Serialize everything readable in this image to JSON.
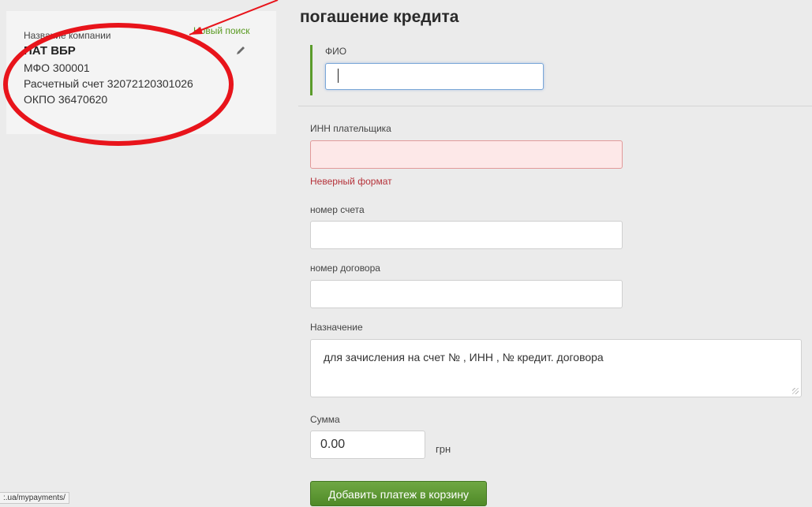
{
  "company": {
    "label": "Название компании",
    "new_search": "Новый поиск",
    "name": "ПАТ ВБР",
    "mfo": "МФО 300001",
    "account": "Расчетный счет 32072120301026",
    "okpo": "ОКПО 36470620"
  },
  "form": {
    "title": "погашение кредита",
    "fio_label": "ФИО",
    "fio_value": "",
    "inn_label": "ИНН плательщика",
    "inn_value": "",
    "inn_error": "Неверный формат",
    "account_label": "номер счета",
    "account_value": "",
    "contract_label": "номер договора",
    "contract_value": "",
    "purpose_label": "Назначение",
    "purpose_value": "для зачисления на счет № ,  ИНН , № кредит. договора",
    "amount_label": "Сумма",
    "amount_value": "0.00",
    "currency": "грн",
    "submit_label": "Добавить платеж в корзину"
  },
  "status_bar": {
    "url": ":.ua/mypayments/"
  },
  "colors": {
    "accent_green": "#5b9c2b",
    "error_red": "#b5323a",
    "annotation_red": "#e8141b"
  },
  "icons": {
    "edit": "pencil-icon"
  }
}
